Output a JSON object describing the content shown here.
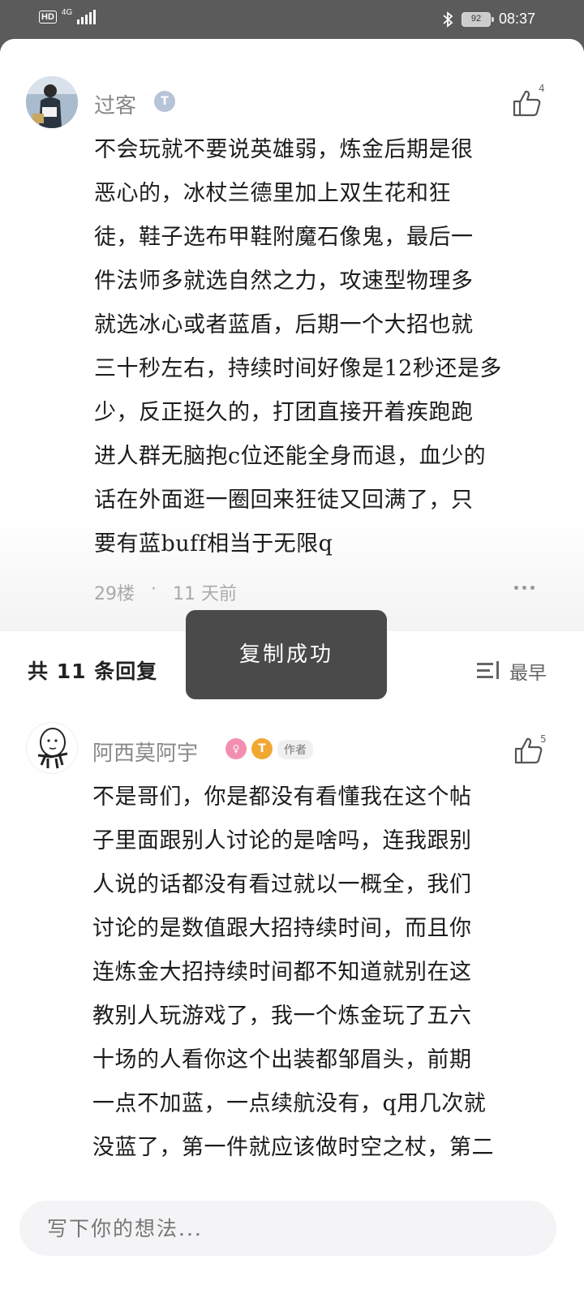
{
  "status_bar": {
    "hd": "HD",
    "network": "4G",
    "battery": "92",
    "time": "08:37"
  },
  "main_comment": {
    "username": "过客",
    "level_badge": "T",
    "likes": "4",
    "text": "不会玩就不要说英雄弱，炼金后期是很\n恶心的，冰杖兰德里加上双生花和狂\n徒，鞋子选布甲鞋附魔石像鬼，最后一\n件法师多就选自然之力，攻速型物理多\n就选冰心或者蓝盾，后期一个大招也就\n三十秒左右，持续时间好像是12秒还是多\n少，反正挺久的，打团直接开着疾跑跑\n进人群无脑抱c位还能全身而退，血少的\n话在外面逛一圈回来狂徒又回满了，只\n要有蓝buff相当于无限q",
    "floor": "29楼",
    "dot": "·",
    "time": "11 天前"
  },
  "replies_header": {
    "count_label": "共 11 条回复",
    "sort_label": "最早"
  },
  "toast": {
    "text": "复制成功"
  },
  "reply": {
    "username": "阿西莫阿宇",
    "level_badge": "T",
    "author_tag": "作者",
    "likes": "5",
    "text": "不是哥们，你是都没有看懂我在这个帖\n子里面跟别人讨论的是啥吗，连我跟别\n人说的话都没有看过就以一概全，我们\n讨论的是数值跟大招持续时间，而且你\n连炼金大招持续时间都不知道就别在这\n教别人玩游戏了，我一个炼金玩了五六\n十场的人看你这个出装都邹眉头，前期\n一点不加蓝，一点续航没有，q用几次就\n没蓝了，第一件就应该做时空之杖，第二"
  },
  "input": {
    "placeholder": "写下你的想法..."
  },
  "colors": {
    "accent_badge": "#f0a832",
    "level_badge_main": "#b7c3d6",
    "pink_badge": "#f28fb0",
    "toast_bg": "#4a4a4a"
  }
}
